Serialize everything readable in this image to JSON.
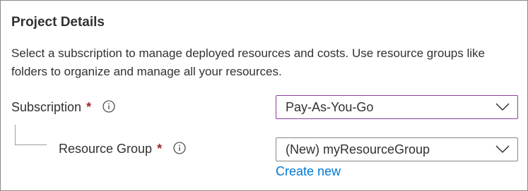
{
  "section": {
    "title": "Project Details",
    "description": "Select a subscription to manage deployed resources and costs. Use resource groups like folders to organize and manage all your resources."
  },
  "subscription": {
    "label": "Subscription",
    "required_mark": "*",
    "info_icon": "info-icon",
    "selected_value": "Pay-As-You-Go"
  },
  "resource_group": {
    "label": "Resource Group",
    "required_mark": "*",
    "info_icon": "info-icon",
    "selected_value": "(New) myResourceGroup",
    "create_new_link": "Create new"
  },
  "colors": {
    "required": "#a4262c",
    "link": "#0078d4",
    "focused_border": "#8a3d9c",
    "border": "#8a8886"
  }
}
